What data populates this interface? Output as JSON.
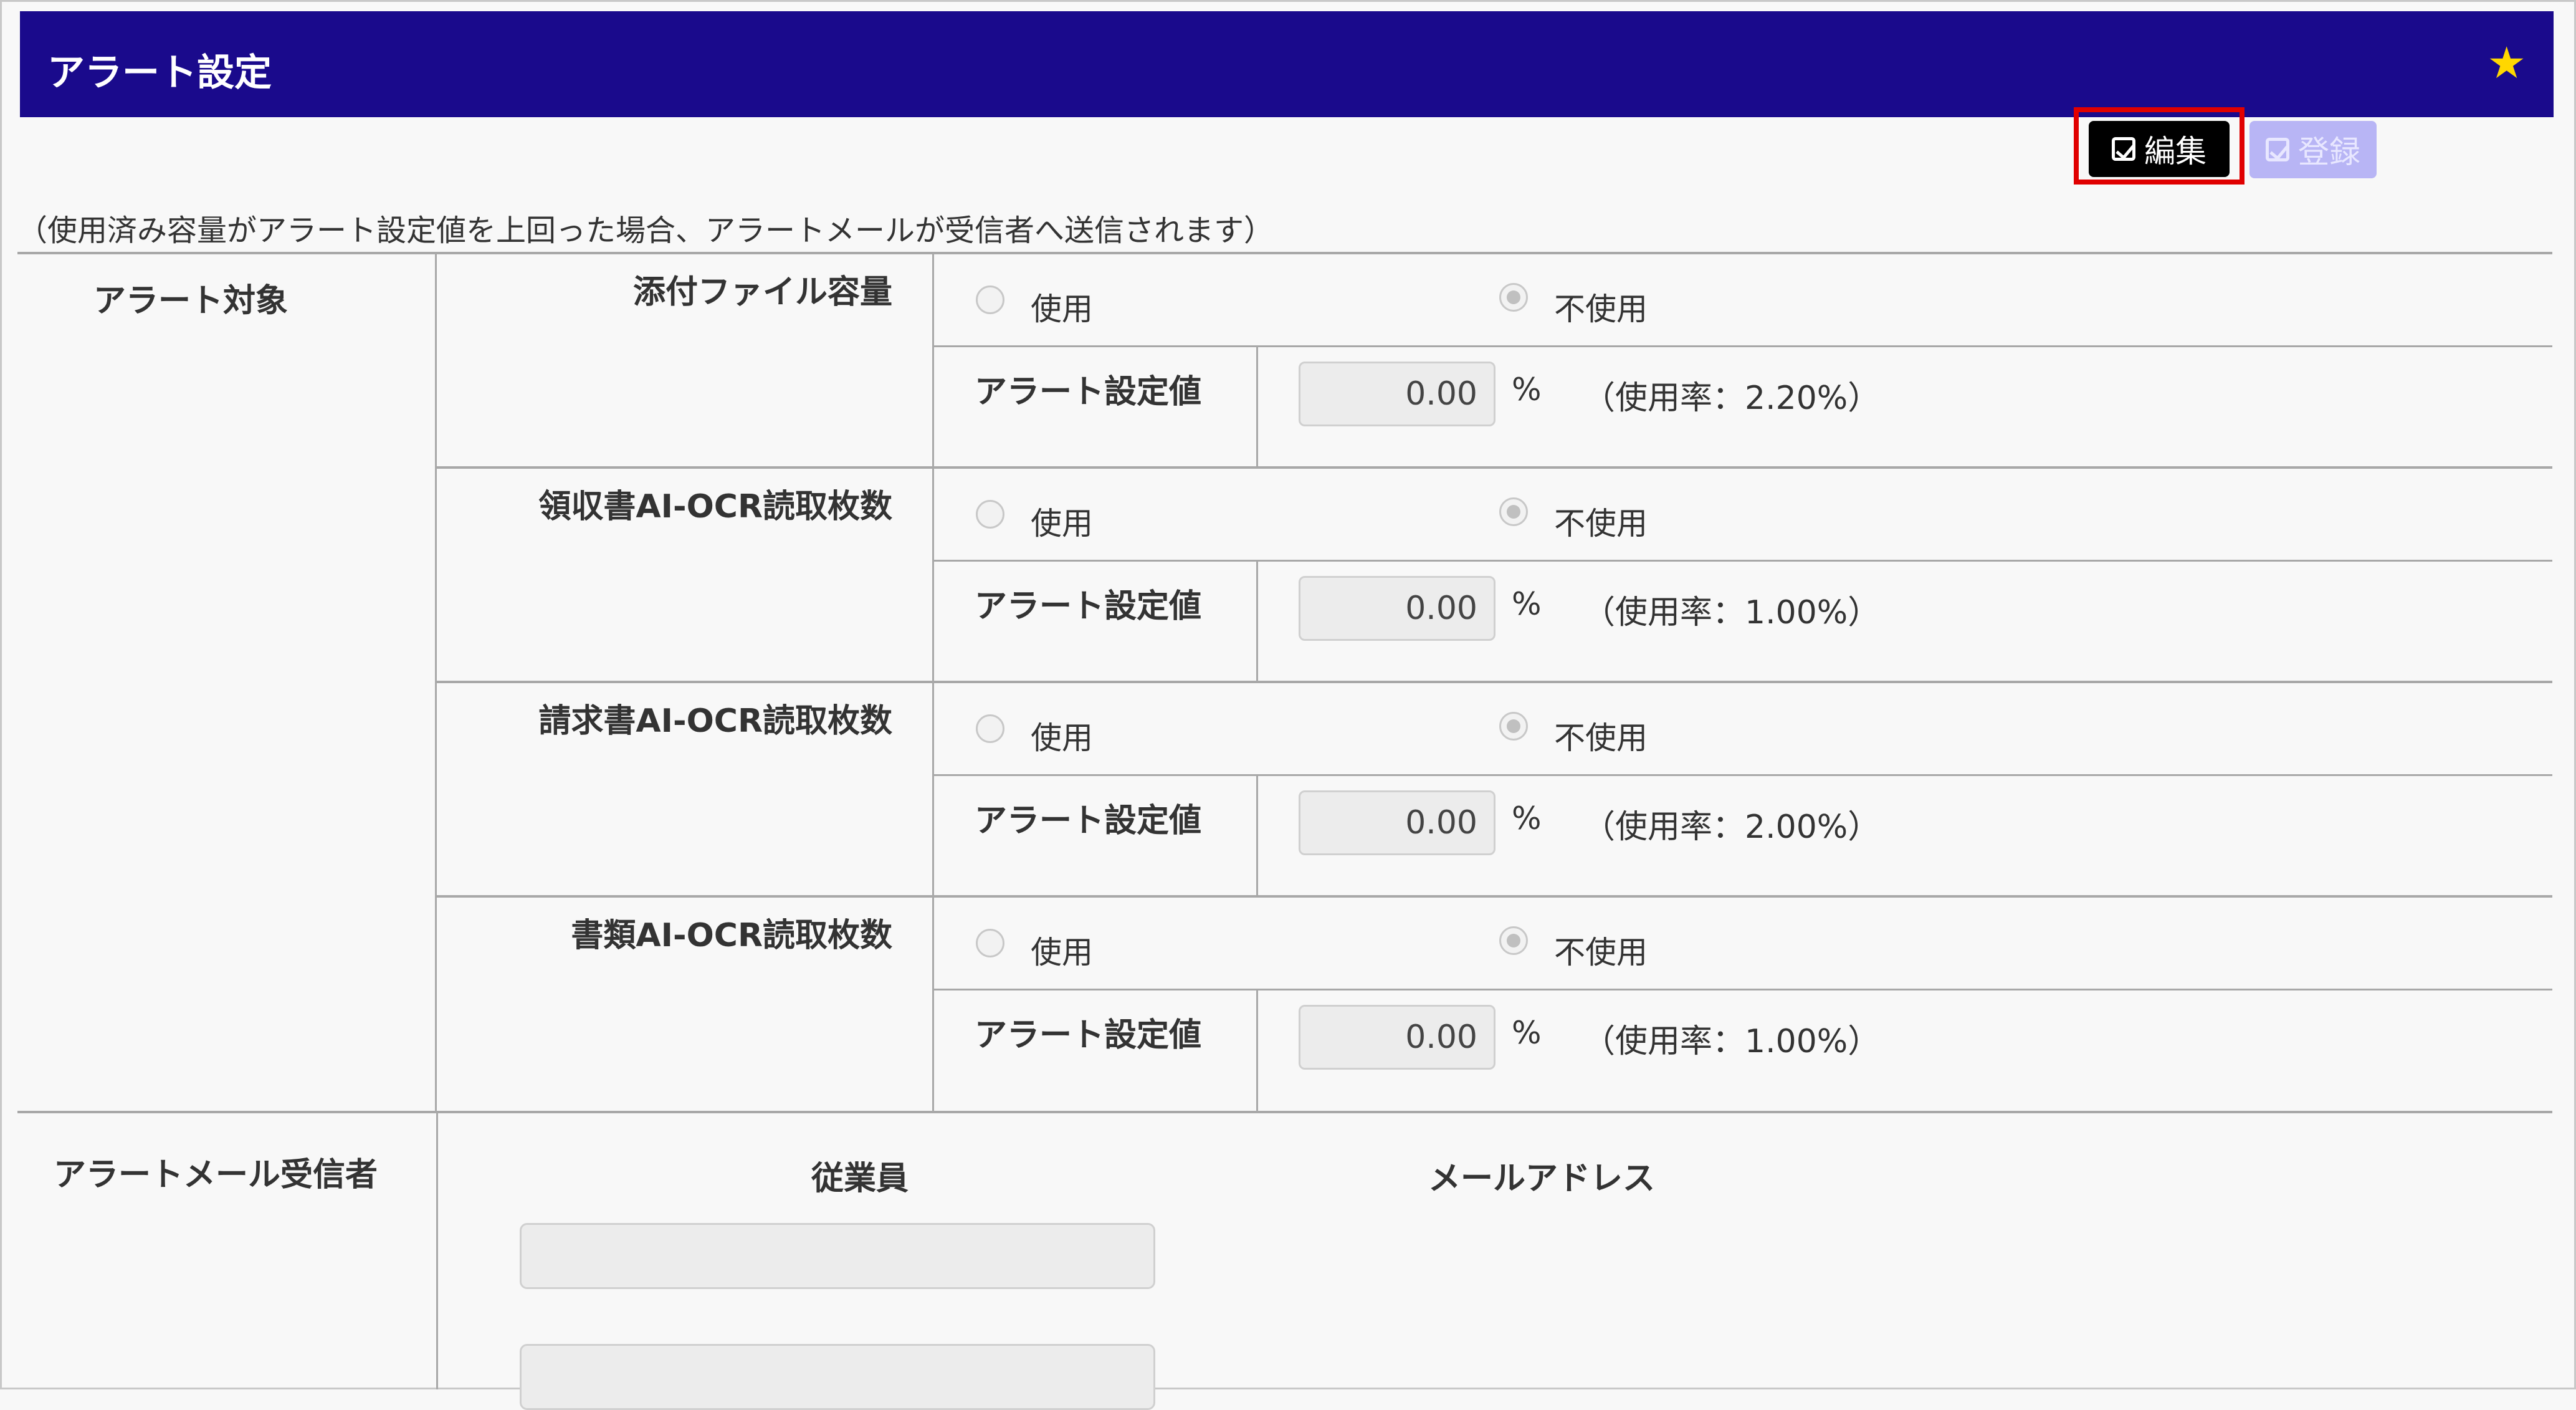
{
  "header": {
    "title": "アラート設定",
    "star_icon": "star-icon"
  },
  "toolbar": {
    "edit_label": "編集",
    "register_label": "登録"
  },
  "note": "（使用済み容量がアラート設定値を上回った場合、アラートメールが受信者へ送信されます）",
  "alert_target_label": "アラート対象",
  "items": [
    {
      "name": "添付ファイル容量",
      "use_label": "使用",
      "nouse_label": "不使用",
      "selected": "不使用",
      "setting_label": "アラート設定値",
      "value": "0.00",
      "unit": "%",
      "rate": "（使用率：2.20%）"
    },
    {
      "name": "領収書AI-OCR読取枚数",
      "use_label": "使用",
      "nouse_label": "不使用",
      "selected": "不使用",
      "setting_label": "アラート設定値",
      "value": "0.00",
      "unit": "%",
      "rate": "（使用率：1.00%）"
    },
    {
      "name": "請求書AI-OCR読取枚数",
      "use_label": "使用",
      "nouse_label": "不使用",
      "selected": "不使用",
      "setting_label": "アラート設定値",
      "value": "0.00",
      "unit": "%",
      "rate": "（使用率：2.00%）"
    },
    {
      "name": "書類AI-OCR読取枚数",
      "use_label": "使用",
      "nouse_label": "不使用",
      "selected": "不使用",
      "setting_label": "アラート設定値",
      "value": "0.00",
      "unit": "%",
      "rate": "（使用率：1.00%）"
    }
  ],
  "recipients": {
    "label": "アラートメール受信者",
    "columns": [
      "従業員",
      "メールアドレス"
    ],
    "employee_inputs": [
      "",
      ""
    ]
  }
}
